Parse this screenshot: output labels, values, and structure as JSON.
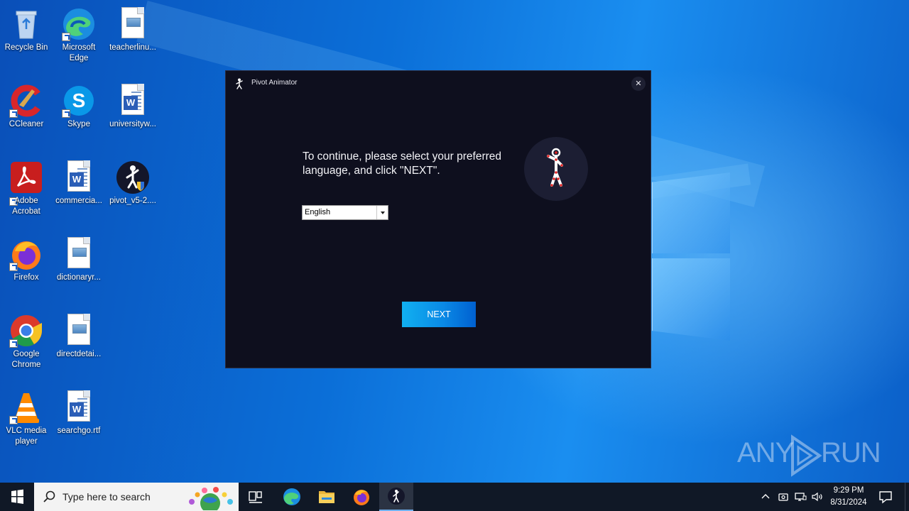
{
  "desktop": {
    "icons": [
      {
        "label": "Recycle Bin",
        "icon": "recycle-bin-icon"
      },
      {
        "label": "Microsoft Edge",
        "icon": "edge-icon"
      },
      {
        "label": "teacherlinu...",
        "icon": "image-file-icon"
      },
      {
        "label": "CCleaner",
        "icon": "ccleaner-icon"
      },
      {
        "label": "Skype",
        "icon": "skype-icon"
      },
      {
        "label": "universityw...",
        "icon": "word-doc-icon"
      },
      {
        "label": "Adobe Acrobat",
        "icon": "acrobat-icon"
      },
      {
        "label": "commercia...",
        "icon": "word-doc-icon"
      },
      {
        "label": "pivot_v5-2....",
        "icon": "pivot-installer-icon"
      },
      {
        "label": "Firefox",
        "icon": "firefox-icon"
      },
      {
        "label": "dictionaryr...",
        "icon": "image-file-icon"
      },
      {
        "label": "Google Chrome",
        "icon": "chrome-icon"
      },
      {
        "label": "directdetai...",
        "icon": "image-file-icon"
      },
      {
        "label": "VLC media player",
        "icon": "vlc-icon"
      },
      {
        "label": "searchgo.rtf",
        "icon": "word-doc-icon"
      }
    ]
  },
  "dialog": {
    "title": "Pivot Animator",
    "close_glyph": "✕",
    "message": "To continue, please select your preferred language, and click \"NEXT\".",
    "language": {
      "selected": "English"
    },
    "next_label": "NEXT",
    "accent": "#0a8ae6",
    "background": "#0e0f1e"
  },
  "watermark": {
    "left": "ANY",
    "right": "RUN"
  },
  "taskbar": {
    "search_placeholder": "Type here to search",
    "pinned": [
      {
        "icon": "task-view-icon"
      },
      {
        "icon": "edge-icon"
      },
      {
        "icon": "file-explorer-icon"
      },
      {
        "icon": "firefox-icon"
      },
      {
        "icon": "pivot-animator-icon",
        "active": true
      }
    ],
    "clock": {
      "time": "9:29 PM",
      "date": "8/31/2024"
    }
  }
}
